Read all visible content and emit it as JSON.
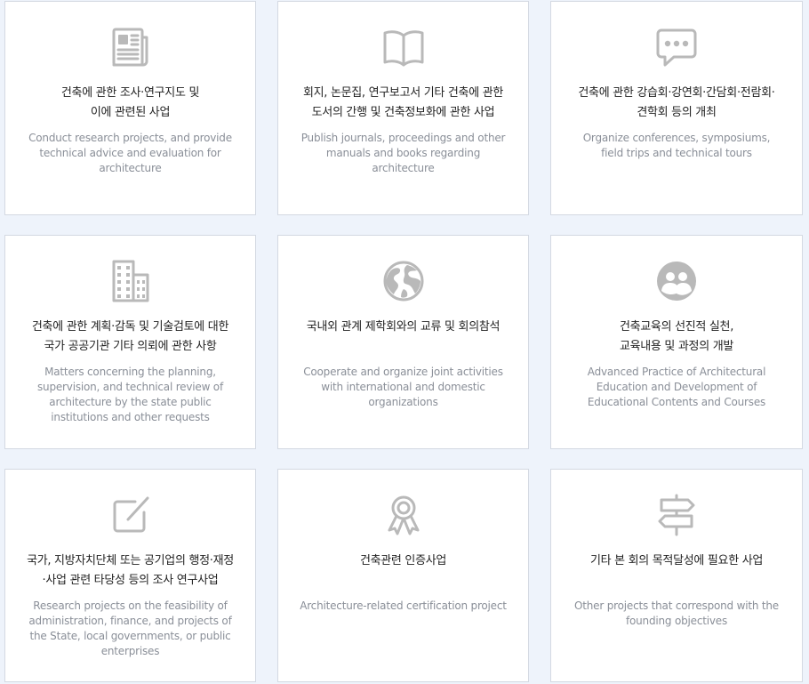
{
  "colors": {
    "background": "#eef3fb",
    "card": "#ffffff",
    "border": "#d4d9e2",
    "title": "#222222",
    "description": "#8a8f98",
    "icon": "#b9b9b9"
  },
  "cards": [
    {
      "icon": "newspaper-icon",
      "title_lines": [
        "건축에 관한 조사·연구지도 및",
        "이에 관련된 사업"
      ],
      "description": "Conduct research projects, and provide technical advice and evaluation for architecture"
    },
    {
      "icon": "open-book-icon",
      "title_lines": [
        "회지, 논문집, 연구보고서 기타 건축에 관한",
        "도서의 간행 및 건축정보화에 관한 사업"
      ],
      "description": "Publish journals, proceedings and other manuals and books regarding architecture"
    },
    {
      "icon": "speech-bubble-icon",
      "title_lines": [
        "건축에 관한 강습회·강연회·간담회·전람회·",
        "견학회 등의 개최"
      ],
      "description": "Organize conferences, symposiums, field trips and technical tours"
    },
    {
      "icon": "building-icon",
      "title_lines": [
        "건축에 관한 계획·감독 및 기술검토에 대한",
        "국가 공공기관 기타 의뢰에 관한 사항"
      ],
      "description": "Matters concerning the planning, supervision, and technical review of architecture by the state public institutions and other requests"
    },
    {
      "icon": "globe-icon",
      "title_lines": [
        "국내외 관계 제학회와의 교류 및 회의참석"
      ],
      "description": "Cooperate and organize joint activities with international and domestic organizations"
    },
    {
      "icon": "people-icon",
      "title_lines": [
        "건축교육의 선진적 실천,",
        "교육내용 및 과정의 개발"
      ],
      "description": "Advanced Practice of Architectural Education and Development of Educational Contents and Courses"
    },
    {
      "icon": "edit-icon",
      "title_lines": [
        "국가, 지방자치단체 또는 공기업의 행정·재정",
        "·사업 관련 타당성 등의 조사 연구사업"
      ],
      "description": "Research projects on the feasibility of administration, finance, and projects of the State, local governments, or public enterprises"
    },
    {
      "icon": "award-ribbon-icon",
      "title_lines": [
        "건축관련 인증사업"
      ],
      "description": "Architecture-related certification project"
    },
    {
      "icon": "signpost-icon",
      "title_lines": [
        "기타 본 회의 목적달성에 필요한 사업"
      ],
      "description": "Other projects that correspond with the founding objectives"
    }
  ]
}
